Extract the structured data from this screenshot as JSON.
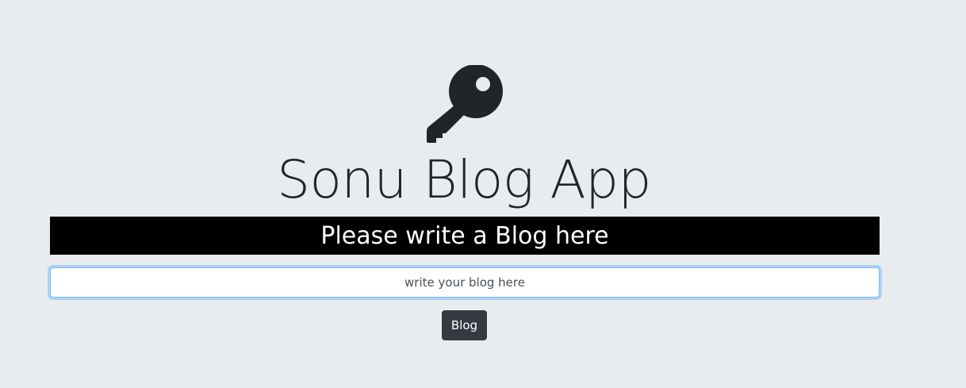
{
  "app": {
    "icon": "key-icon",
    "title": "Sonu Blog App"
  },
  "banner": {
    "text": "Please write a Blog here"
  },
  "blog_form": {
    "input_placeholder": "write your blog here",
    "input_value": "",
    "submit_label": "Blog"
  },
  "colors": {
    "page_background": "#e9ecef",
    "banner_background": "#000000",
    "banner_text": "#ffffff",
    "button_background": "#343a40",
    "input_focus_border": "#80bdff",
    "icon": "#212529"
  }
}
